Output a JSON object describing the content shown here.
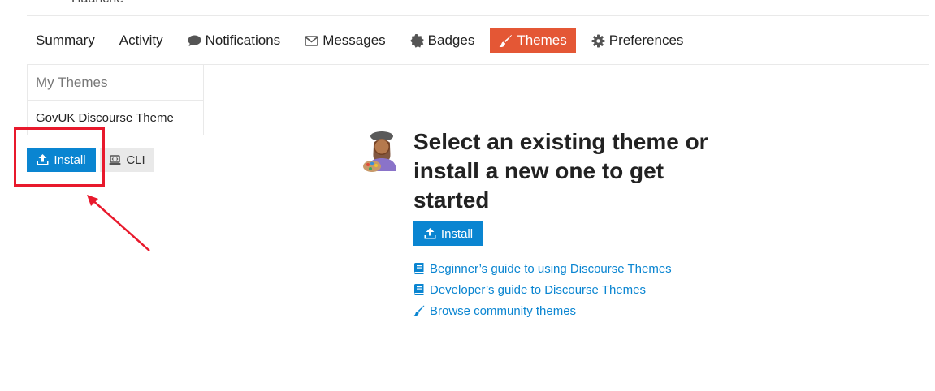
{
  "header": {
    "clipped_text": "Haanche"
  },
  "nav": {
    "items": [
      {
        "label": "Summary",
        "icon": ""
      },
      {
        "label": "Activity",
        "icon": ""
      },
      {
        "label": "Notifications",
        "icon": "comment-icon"
      },
      {
        "label": "Messages",
        "icon": "envelope-icon"
      },
      {
        "label": "Badges",
        "icon": "certificate-icon"
      },
      {
        "label": "Themes",
        "icon": "paintbrush-icon",
        "active": true
      },
      {
        "label": "Preferences",
        "icon": "gear-icon"
      }
    ]
  },
  "sidebar": {
    "heading": "My Themes",
    "themes": [
      "GovUK Discourse Theme"
    ],
    "install_label": "Install",
    "cli_label": "CLI"
  },
  "empty_state": {
    "title": "Select an existing theme or install a new one to get started",
    "install_label": "Install",
    "links": [
      {
        "label": "Beginner’s guide to using Discourse Themes",
        "icon": "book-icon"
      },
      {
        "label": "Developer’s guide to Discourse Themes",
        "icon": "book-icon"
      },
      {
        "label": "Browse community themes",
        "icon": "paintbrush-icon"
      }
    ]
  },
  "colors": {
    "accent": "#e45735",
    "primary_button": "#0a85d1",
    "link": "#0a85d1",
    "annotation": "#e8192c"
  }
}
